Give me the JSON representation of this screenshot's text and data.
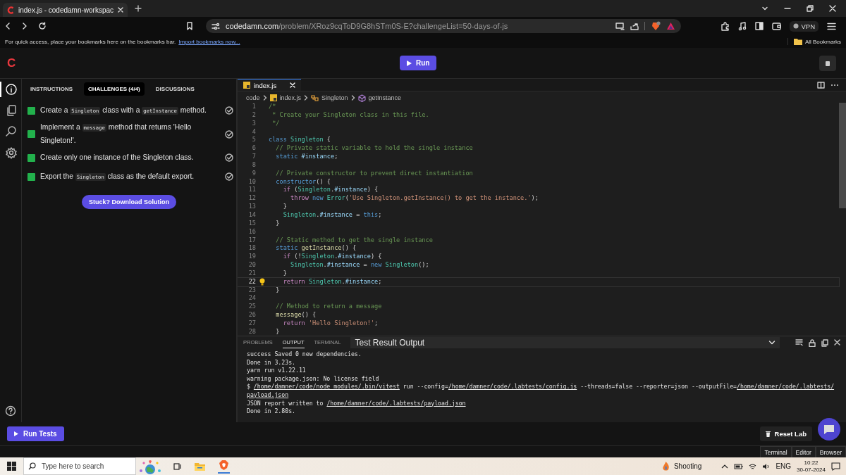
{
  "browser": {
    "tab": {
      "title": "index.js - codedamn-workspac"
    },
    "url": {
      "host": "codedamn.com",
      "path": "/problem/XRoz9cqToD9G8hSTm0S-E?challengeList=50-days-of-js"
    },
    "vpn": "VPN",
    "bookmarks_bar": {
      "message": "For quick access, place your bookmarks here on the bookmarks bar.",
      "link": "Import bookmarks now...",
      "all": "All Bookmarks"
    }
  },
  "header": {
    "logo": "C",
    "run": "Run"
  },
  "rail": [
    {
      "kind": "info",
      "selected": true
    },
    {
      "kind": "files",
      "selected": false
    },
    {
      "kind": "search",
      "selected": false
    },
    {
      "kind": "settings",
      "selected": false
    }
  ],
  "panel": {
    "tabs": [
      {
        "label": "INSTRUCTIONS",
        "selected": false
      },
      {
        "label": "CHALLENGES (4/4)",
        "selected": true
      },
      {
        "label": "DISCUSSIONS",
        "selected": false
      }
    ],
    "challenges": [
      {
        "done": true,
        "parts": [
          {
            "kind": "text",
            "text": "Create a "
          },
          {
            "kind": "code",
            "text": "Singleton"
          },
          {
            "kind": "text",
            "text": " class with a "
          },
          {
            "kind": "code",
            "text": "getInstance"
          },
          {
            "kind": "text",
            "text": " method."
          }
        ]
      },
      {
        "done": true,
        "parts": [
          {
            "kind": "text",
            "text": "Implement a "
          },
          {
            "kind": "code",
            "text": "message"
          },
          {
            "kind": "text",
            "text": " method that returns 'Hello Singleton!'."
          }
        ]
      },
      {
        "done": true,
        "parts": [
          {
            "kind": "text",
            "text": "Create only one instance of the Singleton class."
          }
        ]
      },
      {
        "done": true,
        "parts": [
          {
            "kind": "text",
            "text": "Export the "
          },
          {
            "kind": "code",
            "text": "Singleton"
          },
          {
            "kind": "text",
            "text": " class as the default export."
          }
        ]
      }
    ],
    "solution_button": "Stuck? Download Solution"
  },
  "editor": {
    "tabs": [
      {
        "label": "index.js",
        "selected": true
      }
    ],
    "breadcrumb": [
      {
        "kind": "folder",
        "text": "code"
      },
      {
        "kind": "file",
        "text": "index.js"
      },
      {
        "kind": "class",
        "text": "Singleton"
      },
      {
        "kind": "method",
        "text": "getInstance"
      }
    ],
    "lines": [
      {
        "number": "1",
        "current": false,
        "tokens": [
          {
            "kind": "comment",
            "text": "/*"
          }
        ]
      },
      {
        "number": "2",
        "current": false,
        "tokens": [
          {
            "kind": "comment",
            "text": " * Create your Singleton class in this file."
          }
        ]
      },
      {
        "number": "3",
        "current": false,
        "tokens": [
          {
            "kind": "comment",
            "text": " */"
          }
        ]
      },
      {
        "number": "4",
        "current": false
      },
      {
        "number": "5",
        "current": false,
        "tokens": [
          {
            "kind": "keyword",
            "text": "class"
          },
          {
            "kind": "type",
            "text": " Singleton"
          },
          {
            "kind": "plain",
            "text": " {"
          }
        ]
      },
      {
        "number": "6",
        "current": false,
        "tokens": [
          {
            "kind": "comment",
            "text": "  // Private static variable to hold the single instance"
          }
        ]
      },
      {
        "number": "7",
        "current": false,
        "tokens": [
          {
            "kind": "keyword",
            "text": "  static"
          },
          {
            "kind": "prop",
            "text": " #instance"
          },
          {
            "kind": "plain",
            "text": ";"
          }
        ]
      },
      {
        "number": "8",
        "current": false
      },
      {
        "number": "9",
        "current": false,
        "tokens": [
          {
            "kind": "comment",
            "text": "  // Private constructor to prevent direct instantiation"
          }
        ]
      },
      {
        "number": "10",
        "current": false,
        "tokens": [
          {
            "kind": "keyword",
            "text": "  constructor"
          },
          {
            "kind": "plain",
            "text": "() {"
          }
        ]
      },
      {
        "number": "11",
        "current": false,
        "tokens": [
          {
            "kind": "control",
            "text": "    if"
          },
          {
            "kind": "plain",
            "text": " ("
          },
          {
            "kind": "type",
            "text": "Singleton"
          },
          {
            "kind": "plain",
            "text": "."
          },
          {
            "kind": "prop",
            "text": "#instance"
          },
          {
            "kind": "plain",
            "text": ") {"
          }
        ]
      },
      {
        "number": "12",
        "current": false,
        "tokens": [
          {
            "kind": "control",
            "text": "      throw"
          },
          {
            "kind": "keyword",
            "text": " new"
          },
          {
            "kind": "type",
            "text": " Error"
          },
          {
            "kind": "plain",
            "text": "("
          },
          {
            "kind": "string",
            "text": "'Use Singleton.getInstance() to get the instance.'"
          },
          {
            "kind": "plain",
            "text": ");"
          }
        ]
      },
      {
        "number": "13",
        "current": false,
        "tokens": [
          {
            "kind": "plain",
            "text": "    }"
          }
        ]
      },
      {
        "number": "14",
        "current": false,
        "tokens": [
          {
            "kind": "type",
            "text": "    Singleton"
          },
          {
            "kind": "plain",
            "text": "."
          },
          {
            "kind": "prop",
            "text": "#instance"
          },
          {
            "kind": "plain",
            "text": " ="
          },
          {
            "kind": "keyword",
            "text": " this"
          },
          {
            "kind": "plain",
            "text": ";"
          }
        ]
      },
      {
        "number": "15",
        "current": false,
        "tokens": [
          {
            "kind": "plain",
            "text": "  }"
          }
        ]
      },
      {
        "number": "16",
        "current": false
      },
      {
        "number": "17",
        "current": false,
        "tokens": [
          {
            "kind": "comment",
            "text": "  // Static method to get the single instance"
          }
        ]
      },
      {
        "number": "18",
        "current": false,
        "tokens": [
          {
            "kind": "keyword",
            "text": "  static"
          },
          {
            "kind": "func",
            "text": " getInstance"
          },
          {
            "kind": "plain",
            "text": "() {"
          }
        ]
      },
      {
        "number": "19",
        "current": false,
        "tokens": [
          {
            "kind": "control",
            "text": "    if"
          },
          {
            "kind": "plain",
            "text": " (!"
          },
          {
            "kind": "type",
            "text": "Singleton"
          },
          {
            "kind": "plain",
            "text": "."
          },
          {
            "kind": "prop",
            "text": "#instance"
          },
          {
            "kind": "plain",
            "text": ") {"
          }
        ]
      },
      {
        "number": "20",
        "current": false,
        "tokens": [
          {
            "kind": "type",
            "text": "      Singleton"
          },
          {
            "kind": "plain",
            "text": "."
          },
          {
            "kind": "prop",
            "text": "#instance"
          },
          {
            "kind": "plain",
            "text": " ="
          },
          {
            "kind": "keyword",
            "text": " new"
          },
          {
            "kind": "type",
            "text": " Singleton"
          },
          {
            "kind": "plain",
            "text": "();"
          }
        ]
      },
      {
        "number": "21",
        "current": false,
        "tokens": [
          {
            "kind": "plain",
            "text": "    }"
          }
        ]
      },
      {
        "number": "22",
        "current": true,
        "tokens": [
          {
            "kind": "control",
            "text": "    return"
          },
          {
            "kind": "type",
            "text": " Singleton"
          },
          {
            "kind": "plain",
            "text": "."
          },
          {
            "kind": "prop",
            "text": "#instance"
          },
          {
            "kind": "plain",
            "text": ";"
          }
        ]
      },
      {
        "number": "23",
        "current": false,
        "tokens": [
          {
            "kind": "plain",
            "text": "  }"
          }
        ]
      },
      {
        "number": "24",
        "current": false
      },
      {
        "number": "25",
        "current": false,
        "tokens": [
          {
            "kind": "comment",
            "text": "  // Method to return a message"
          }
        ]
      },
      {
        "number": "26",
        "current": false,
        "tokens": [
          {
            "kind": "func",
            "text": "  message"
          },
          {
            "kind": "plain",
            "text": "() {"
          }
        ]
      },
      {
        "number": "27",
        "current": false,
        "tokens": [
          {
            "kind": "control",
            "text": "    return"
          },
          {
            "kind": "string",
            "text": " 'Hello Singleton!'"
          },
          {
            "kind": "plain",
            "text": ";"
          }
        ]
      },
      {
        "number": "28",
        "current": false,
        "tokens": [
          {
            "kind": "plain",
            "text": "  }"
          }
        ]
      }
    ]
  },
  "output": {
    "tabs": [
      {
        "label": "PROBLEMS",
        "selected": false
      },
      {
        "label": "OUTPUT",
        "selected": true
      },
      {
        "label": "TERMINAL",
        "selected": false
      }
    ],
    "channel": "Test Result Output",
    "lines": [
      {
        "parts": [
          {
            "text": "success Saved 0 new dependencies.",
            "path": false
          }
        ]
      },
      {
        "parts": [
          {
            "text": "Done in 3.23s.",
            "path": false
          }
        ]
      },
      {
        "parts": [
          {
            "text": "yarn run v1.22.11",
            "path": false
          }
        ]
      },
      {
        "parts": [
          {
            "text": "warning package.json: No license field",
            "path": false
          }
        ]
      },
      {
        "parts": [
          {
            "text": "$ ",
            "path": false
          },
          {
            "text": "/home/damner/code/node_modules/.bin/vitest",
            "path": true
          },
          {
            "text": " run --config=",
            "path": false
          },
          {
            "text": "/home/damner/code/.labtests/config.js",
            "path": true
          },
          {
            "text": " --threads=false --reporter=json --outputFile=",
            "path": false
          },
          {
            "text": "/home/damner/code/.labtests/",
            "path": true
          },
          {
            "text": "payload.json",
            "path": true
          }
        ]
      },
      {
        "parts": [
          {
            "text": "JSON report written to ",
            "path": false
          },
          {
            "text": "/home/damner/code/.labtests/payload.json",
            "path": true
          }
        ]
      },
      {
        "parts": [
          {
            "text": "Done in 2.80s.",
            "path": false
          }
        ]
      }
    ]
  },
  "footer": {
    "run_tests": "Run Tests",
    "reset": "Reset Lab",
    "views": [
      {
        "label": "Terminal"
      },
      {
        "label": "Editor"
      },
      {
        "label": "Browser"
      }
    ]
  },
  "taskbar": {
    "search": {
      "placeholder": "Type here to search"
    },
    "weather": "Shooting",
    "language": "ENG",
    "time": "10:22",
    "date": "30-07-2024"
  }
}
